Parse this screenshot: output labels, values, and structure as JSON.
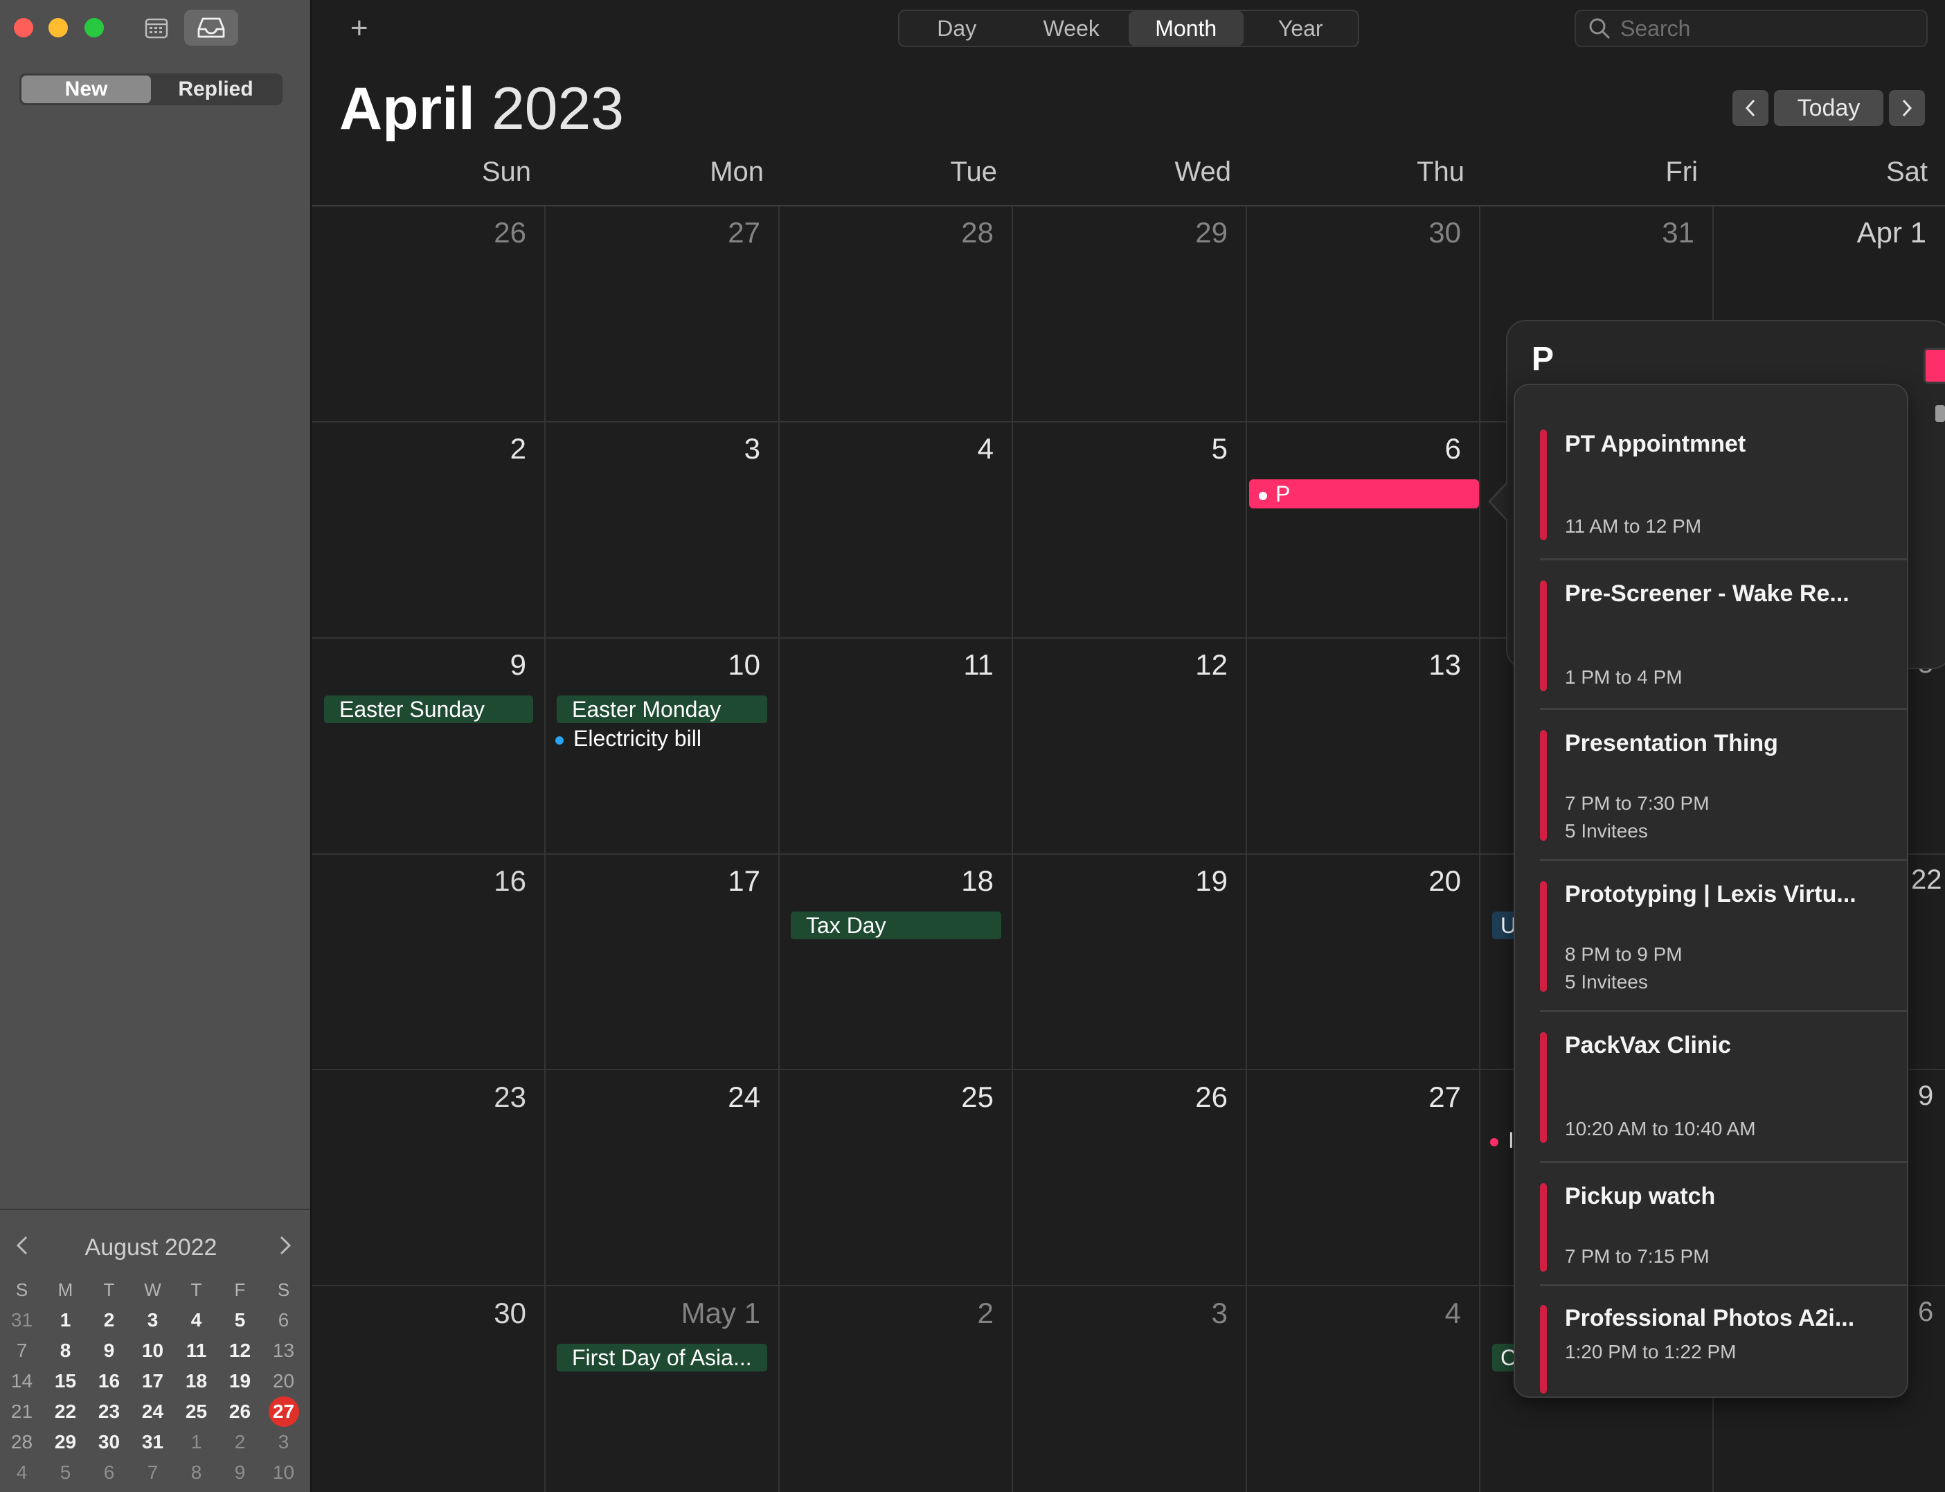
{
  "sidebar": {
    "segments": [
      "New",
      "Replied"
    ],
    "mini_calendar": {
      "title": "August 2022",
      "weekday_headers": [
        "S",
        "M",
        "T",
        "W",
        "T",
        "F",
        "S"
      ],
      "weeks": [
        [
          "31",
          "1",
          "2",
          "3",
          "4",
          "5",
          "6"
        ],
        [
          "7",
          "8",
          "9",
          "10",
          "11",
          "12",
          "13"
        ],
        [
          "14",
          "15",
          "16",
          "17",
          "18",
          "19",
          "20"
        ],
        [
          "21",
          "22",
          "23",
          "24",
          "25",
          "26",
          "27"
        ],
        [
          "28",
          "29",
          "30",
          "31",
          "1",
          "2",
          "3"
        ],
        [
          "4",
          "5",
          "6",
          "7",
          "8",
          "9",
          "10"
        ]
      ],
      "today": "27"
    }
  },
  "toolbar": {
    "add_label": "+",
    "views": [
      "Day",
      "Week",
      "Month",
      "Year"
    ],
    "active_view": "Month",
    "search_placeholder": "Search"
  },
  "header": {
    "month": "April",
    "year": "2023",
    "today_label": "Today"
  },
  "weekdays": [
    "Sun",
    "Mon",
    "Tue",
    "Wed",
    "Thu",
    "Fri",
    "Sat"
  ],
  "weeks": [
    [
      "26",
      "27",
      "28",
      "29",
      "30",
      "31",
      "Apr 1"
    ],
    [
      "2",
      "3",
      "4",
      "5",
      "6",
      "",
      ""
    ],
    [
      "9",
      "10",
      "11",
      "12",
      "13",
      "",
      "5"
    ],
    [
      "16",
      "17",
      "18",
      "19",
      "20",
      "",
      "22"
    ],
    [
      "23",
      "24",
      "25",
      "26",
      "27",
      "",
      "9"
    ],
    [
      "30",
      "May 1",
      "2",
      "3",
      "4",
      "",
      "6"
    ]
  ],
  "events": {
    "easter_sunday": "Easter Sunday",
    "easter_monday": "Easter Monday",
    "electricity_bill": "Electricity bill",
    "tax_day": "Tax Day",
    "new_event": "P",
    "first_day_asia": "First Day of Asia...",
    "fri_cut_1": "U",
    "fri_cut_2": "I",
    "fri_cut_3": "C"
  },
  "popover": {
    "title_value": "P"
  },
  "suggestions": [
    {
      "title": "PT Appointmnet",
      "time": "11 AM to 12 PM",
      "invitees": ""
    },
    {
      "title": "Pre-Screener - Wake Re...",
      "time": "1 PM to 4 PM",
      "invitees": ""
    },
    {
      "title": "Presentation Thing",
      "time": "7 PM to 7:30 PM",
      "invitees": "5 Invitees"
    },
    {
      "title": "Prototyping | Lexis Virtu...",
      "time": "8 PM to 9 PM",
      "invitees": "5 Invitees"
    },
    {
      "title": "PackVax Clinic",
      "time": "10:20 AM to 10:40 AM",
      "invitees": ""
    },
    {
      "title": "Pickup watch",
      "time": "7 PM to 7:15 PM",
      "invitees": ""
    },
    {
      "title": "Professional Photos A2i...",
      "time": "1:20 PM to 1:22 PM",
      "invitees": ""
    }
  ],
  "colors": {
    "accent_red": "#e0302a",
    "event_pink": "#fe2e6a",
    "holiday_green": "#1f4a32",
    "suggestion_bar": "#d11f43",
    "bill_dot": "#2aa5f5"
  }
}
